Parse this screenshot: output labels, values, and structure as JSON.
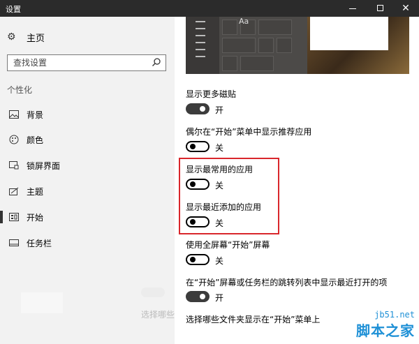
{
  "window": {
    "title": "设置",
    "minimize_glyph": "",
    "close_glyph": "✕"
  },
  "sidebar": {
    "home_label": "主页",
    "search_placeholder": "查找设置",
    "section_label": "个性化",
    "items": [
      {
        "label": "背景",
        "icon": "image-icon"
      },
      {
        "label": "颜色",
        "icon": "palette-icon"
      },
      {
        "label": "锁屏界面",
        "icon": "lock-screen-icon"
      },
      {
        "label": "主题",
        "icon": "theme-icon"
      },
      {
        "label": "开始",
        "icon": "start-icon",
        "active": true
      },
      {
        "label": "任务栏",
        "icon": "taskbar-icon"
      }
    ],
    "faint_text": "选择哪些"
  },
  "main": {
    "preview_aa": "Aa",
    "settings": [
      {
        "label": "显示更多磁贴",
        "state": "开",
        "on": true
      },
      {
        "label": "偶尔在“开始”菜单中显示推荐应用",
        "state": "关",
        "on": false
      },
      {
        "label": "显示最常用的应用",
        "state": "关",
        "on": false
      },
      {
        "label": "显示最近添加的应用",
        "state": "关",
        "on": false
      },
      {
        "label": "使用全屏幕“开始”屏幕",
        "state": "关",
        "on": false
      },
      {
        "label": "在“开始”屏幕或任务栏的跳转列表中显示最近打开的项",
        "state": "开",
        "on": true
      }
    ],
    "folders_link": "选择哪些文件夹显示在“开始”菜单上"
  },
  "watermark": {
    "line1": "jb51.net",
    "line2": "脚本之家"
  },
  "colors": {
    "accent_highlight": "#d9262b",
    "titlebar": "#2b2b2b",
    "sidebar_bg": "#f2f2f2",
    "watermark": "#1e90d6"
  }
}
